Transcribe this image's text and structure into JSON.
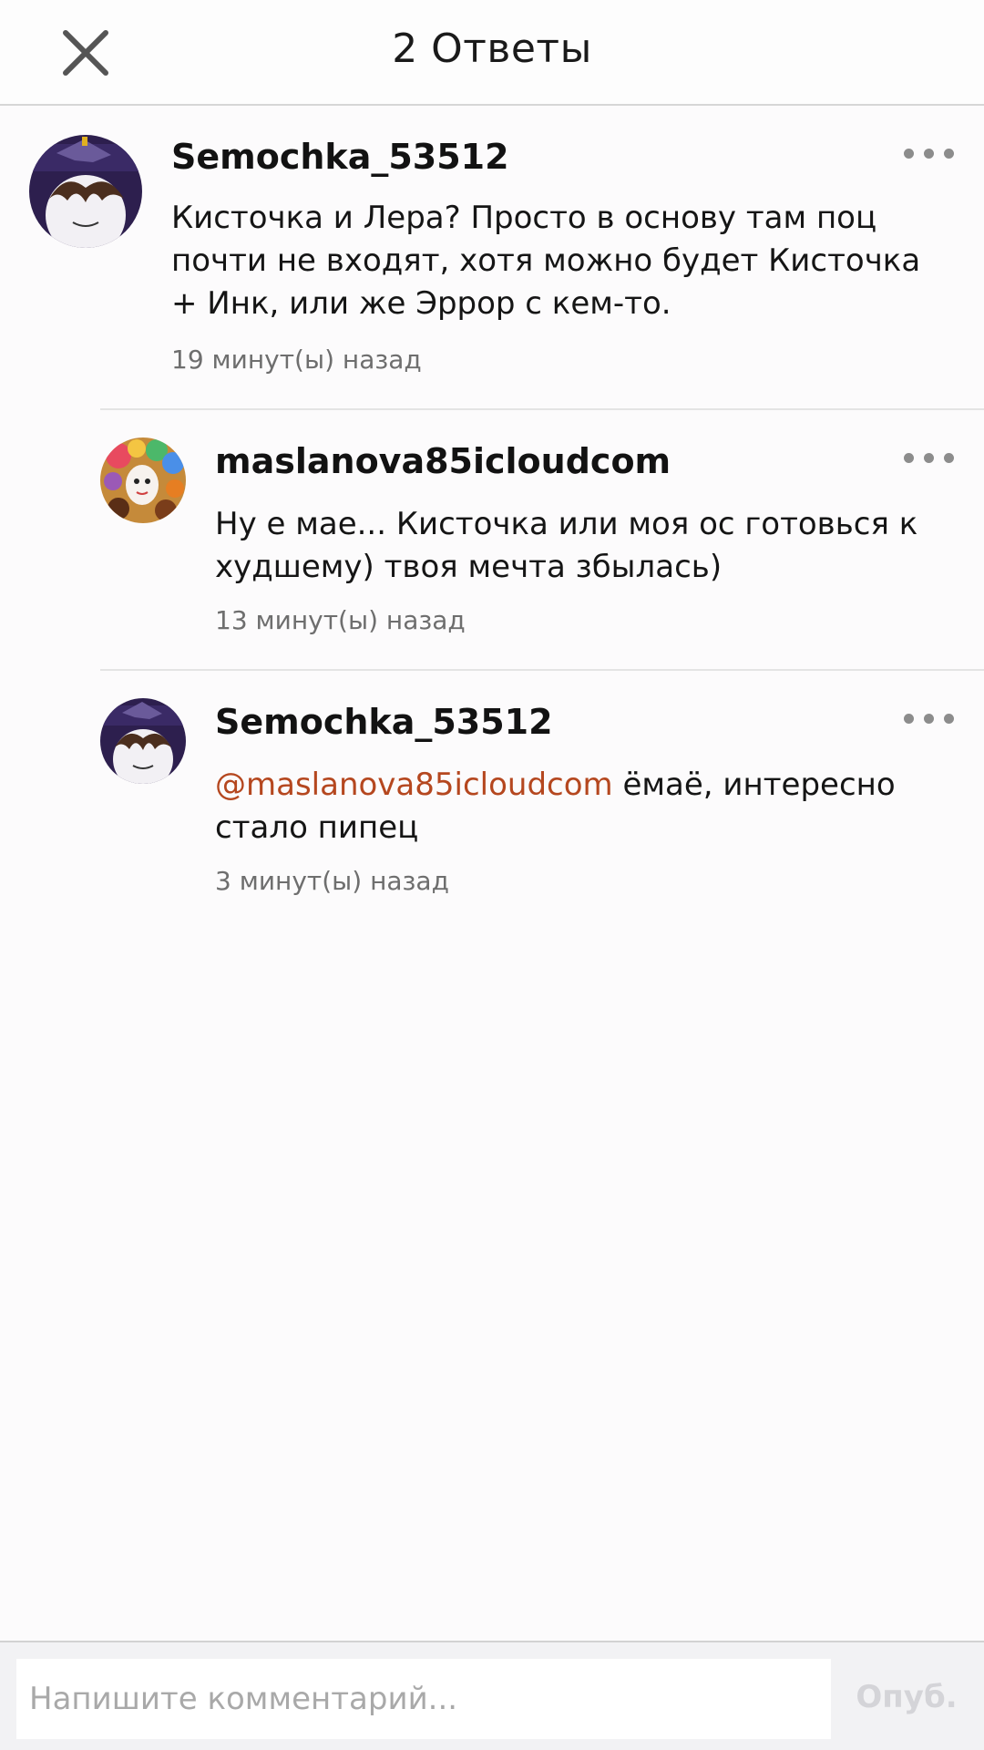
{
  "header": {
    "title": "2 Ответы",
    "close_icon": "close-icon"
  },
  "comments": [
    {
      "username": "Semochka_53512",
      "avatar": "avatar-dark-character",
      "text": "Кисточка и Лера? Просто в основу там поц почти не входят, хотя можно будет Кисточка + Инк, или же Эррор с кем-то.",
      "time": "19 минут(ы) назад",
      "more_icon": "more-dots-icon"
    },
    {
      "username": "maslanova85icloudcom",
      "avatar": "avatar-colorful-character",
      "text": "Ну е мае... Кисточка или моя ос готовься к худшему) твоя мечта збылась)",
      "time": "13 минут(ы) назад",
      "more_icon": "more-dots-icon"
    },
    {
      "username": "Semochka_53512",
      "avatar": "avatar-dark-character",
      "mention": "@maslanova85icloudcom",
      "text": " ёмаё, интересно стало пипец",
      "time": "3 минут(ы) назад",
      "more_icon": "more-dots-icon"
    }
  ],
  "composer": {
    "placeholder": "Напишите комментарий...",
    "publish_label": "Опуб."
  },
  "colors": {
    "mention": "#b5471f",
    "timestamp": "#6e6e6e",
    "publish_disabled": "#d4d4d8"
  }
}
